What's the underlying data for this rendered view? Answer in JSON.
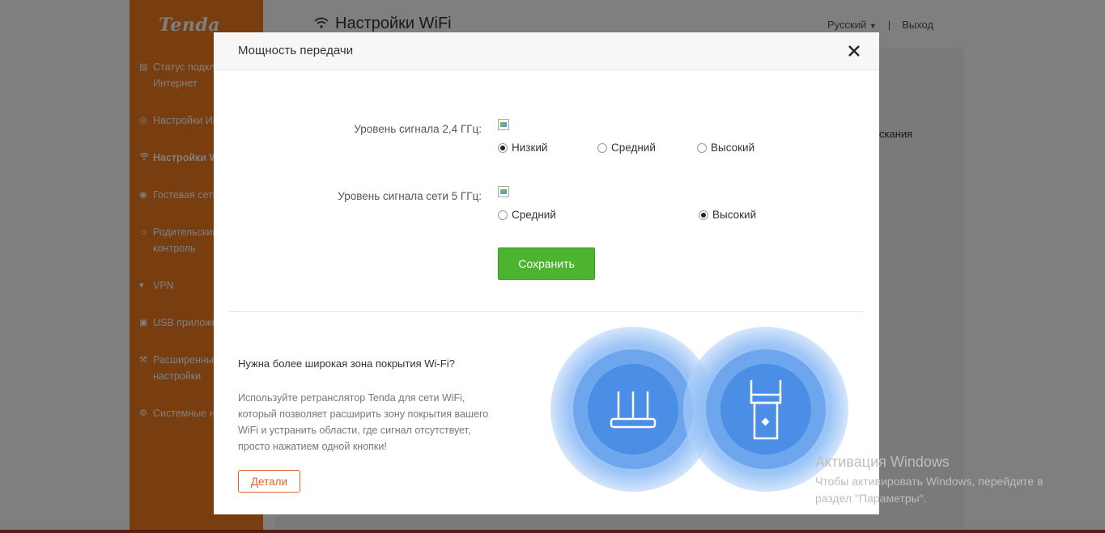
{
  "background": {
    "brand": "Tenda",
    "page_title": "Настройки WiFi",
    "language": "Русский",
    "separator": "|",
    "logout": "Выход",
    "content_fragment": "скания",
    "nav": [
      {
        "label": "Статус подкл\nИнтернет",
        "icon": "status-icon"
      },
      {
        "label": "Настройки Ин",
        "icon": "globe-icon"
      },
      {
        "label": "Настройки W",
        "icon": "wifi-icon",
        "active": true
      },
      {
        "label": "Гостевая сеть",
        "icon": "guest-icon"
      },
      {
        "label": "Родительский\nконтроль",
        "icon": "parental-icon"
      },
      {
        "label": "VPN",
        "icon": "vpn-icon"
      },
      {
        "label": "USB приложе",
        "icon": "usb-icon"
      },
      {
        "label": "Расширенны\nнастройки",
        "icon": "tools-icon"
      },
      {
        "label": "Системные н",
        "icon": "gear-icon"
      }
    ]
  },
  "modal": {
    "title": "Мощность передачи",
    "band24": {
      "label": "Уровень сигнала 2,4 ГГц:",
      "options": [
        "Низкий",
        "Средний",
        "Высокий"
      ],
      "selected": "Низкий"
    },
    "band5": {
      "label": "Уровень сигнала сети 5 ГГц:",
      "options": [
        "Средний",
        "Высокий"
      ],
      "selected": "Высокий"
    },
    "save_label": "Сохранить",
    "promo": {
      "title": "Нужна более широкая зона покрытия Wi-Fi?",
      "text": "Используйте ретранслятор Tenda для сети WiFi, который позволяет расширить зону покрытия вашего WiFi и устранить области, где сигнал отсутствует, просто нажатием одной кнопки!",
      "details_label": "Детали"
    }
  },
  "watermark": {
    "title": "Активация Windows",
    "line1": "Чтобы активировать Windows, перейдите в",
    "line2": "раздел \"Параметры\"."
  },
  "colors": {
    "sidebar": "#f07c21",
    "save_button": "#4db42f",
    "details_button": "#e0642a",
    "bubble": "#4a8ee6"
  }
}
